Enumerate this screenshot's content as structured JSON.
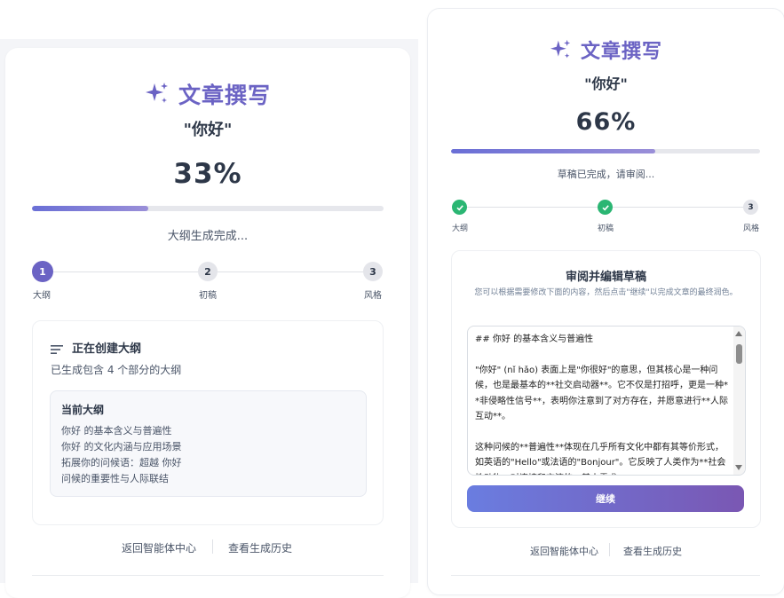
{
  "left": {
    "title": "文章撰写",
    "subtitle": "\"你好\"",
    "percent": "33%",
    "progress": 0.33,
    "status": "大纲生成完成...",
    "steps": [
      {
        "num": "1",
        "label": "大纲",
        "state": "active"
      },
      {
        "num": "2",
        "label": "初稿",
        "state": "pending"
      },
      {
        "num": "3",
        "label": "风格",
        "state": "pending"
      }
    ],
    "outline_section": {
      "heading": "正在创建大纲",
      "description": "已生成包含 4 个部分的大纲",
      "current_heading": "当前大纲",
      "items": [
        "你好 的基本含义与普遍性",
        "你好 的文化内涵与应用场景",
        "拓展你的问候语：超越 你好",
        "问候的重要性与人际联结"
      ]
    },
    "links": {
      "back": "返回智能体中心",
      "history": "查看生成历史"
    }
  },
  "right": {
    "title": "文章撰写",
    "subtitle": "\"你好\"",
    "percent": "66%",
    "progress": 0.66,
    "status": "草稿已完成，请审阅...",
    "steps": [
      {
        "num": "1",
        "label": "大纲",
        "state": "done"
      },
      {
        "num": "2",
        "label": "初稿",
        "state": "done"
      },
      {
        "num": "3",
        "label": "风格",
        "state": "pending"
      }
    ],
    "review": {
      "heading": "审阅并编辑草稿",
      "description": "您可以根据需要修改下面的内容，然后点击\"继续\"以完成文章的最终润色。",
      "draft_text": "## 你好 的基本含义与普遍性\n\n\"你好\" (nǐ hǎo) 表面上是\"你很好\"的意思，但其核心是一种问候，也是最基本的**社交启动器**。它不仅是打招呼，更是一种**非侵略性信号**，表明你注意到了对方存在，并愿意进行**人际互动**。\n\n这种问候的**普遍性**体现在几乎所有文化中都有其等价形式，如英语的\"Hello\"或法语的\"Bonjour\"。它反映了人类作为**社会性动物**对连接和交流的**基本需求**。",
      "continue_label": "继续"
    },
    "links": {
      "back": "返回智能体中心",
      "history": "查看生成历史"
    }
  },
  "colors": {
    "accent": "#6b63c4",
    "done": "#2bb673",
    "active": "#6b63c4"
  }
}
